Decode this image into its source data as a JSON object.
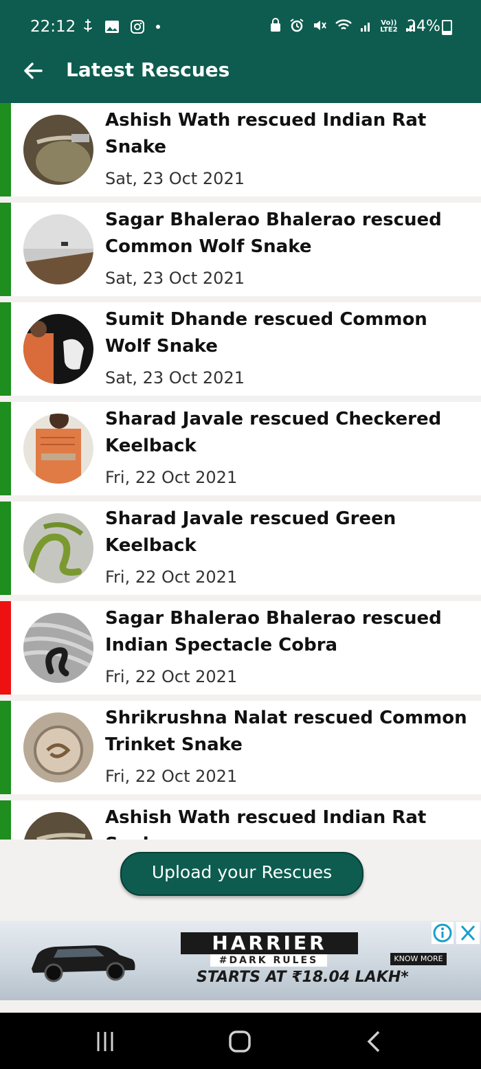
{
  "status_bar": {
    "time": "22:12",
    "battery": "24%",
    "battery_level": 0.24,
    "left_icons": [
      "usb-icon",
      "image-icon",
      "instagram-icon",
      "dot-icon"
    ],
    "right_icons": [
      "lock-icon",
      "alarm-icon",
      "mute-icon",
      "wifi-icon",
      "signal-icon",
      "volte-icon",
      "signal-icon",
      "battery-icon"
    ],
    "volte_text": "Vo))",
    "lte_text": "LTE2"
  },
  "app_bar": {
    "title": "Latest Rescues",
    "back_icon": "arrow-left-icon"
  },
  "rescues": [
    {
      "title": "Ashish Wath rescued Indian Rat Snake",
      "date": "Sat, 23 Oct 2021",
      "status_color": "#1e8e1e"
    },
    {
      "title": "Sagar Bhalerao Bhalerao rescued Common Wolf Snake",
      "date": "Sat, 23 Oct 2021",
      "status_color": "#1e8e1e"
    },
    {
      "title": "Sumit Dhande rescued Common Wolf Snake",
      "date": "Sat, 23 Oct 2021",
      "status_color": "#1e8e1e"
    },
    {
      "title": "Sharad Javale rescued Checkered Keelback",
      "date": "Fri, 22 Oct 2021",
      "status_color": "#1e8e1e"
    },
    {
      "title": "Sharad Javale rescued Green Keelback",
      "date": "Fri, 22 Oct 2021",
      "status_color": "#1e8e1e"
    },
    {
      "title": "Sagar Bhalerao Bhalerao rescued Indian Spectacle Cobra",
      "date": "Fri, 22 Oct 2021",
      "status_color": "#ee1111"
    },
    {
      "title": "Shrikrushna Nalat rescued Common Trinket Snake",
      "date": "Fri, 22 Oct 2021",
      "status_color": "#1e8e1e"
    },
    {
      "title": "Ashish Wath rescued Indian Rat Snake",
      "date": "",
      "status_color": "#1e8e1e"
    }
  ],
  "upload_button": {
    "label": "Upload your Rescues"
  },
  "ad": {
    "brand": "HARRIER",
    "tagline": "#DARK RULES",
    "price": "STARTS AT ₹18.04 LAKH*",
    "cta": "KNOW MORE",
    "info_icon": "info-icon",
    "close_icon": "close-icon"
  },
  "nav_bar": {
    "icons": [
      "recents-icon",
      "home-icon",
      "back-icon"
    ]
  },
  "colors": {
    "primary": "#0d5c4f",
    "safe_stripe": "#1e8e1e",
    "danger_stripe": "#ee1111"
  }
}
